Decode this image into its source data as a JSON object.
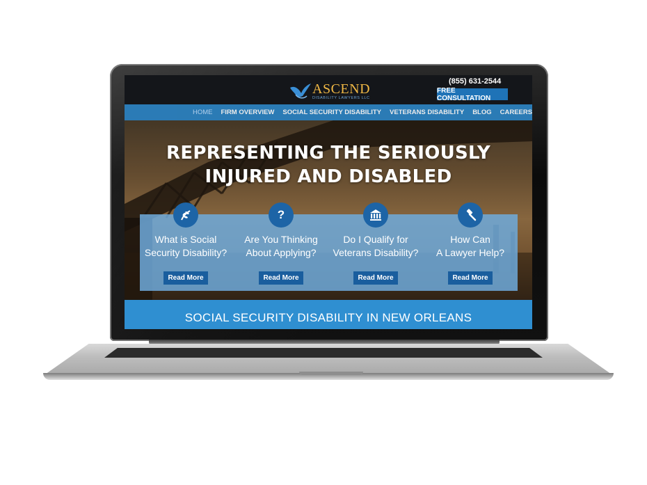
{
  "header": {
    "logo_text": "ASCEND",
    "logo_subtext": "DISABILITY LAWYERS LLC",
    "phone": "(855) 631-2544",
    "consult_label": "FREE CONSULTATION"
  },
  "nav": {
    "items": [
      {
        "label": "HOME",
        "active": true
      },
      {
        "label": "FIRM OVERVIEW"
      },
      {
        "label": "SOCIAL SECURITY DISABILITY"
      },
      {
        "label": "VETERANS DISABILITY"
      },
      {
        "label": "BLOG"
      },
      {
        "label": "CAREERS"
      }
    ]
  },
  "hero": {
    "headline_line1": "REPRESENTING THE SERIOUSLY",
    "headline_line2": "INJURED AND DISABLED"
  },
  "cards": [
    {
      "icon": "leaf-icon",
      "title_line1": "What is Social",
      "title_line2": "Security Disability?",
      "button": "Read More"
    },
    {
      "icon": "question-icon",
      "glyph": "?",
      "title_line1": "Are You Thinking",
      "title_line2": "About Applying?",
      "button": "Read More"
    },
    {
      "icon": "government-building-icon",
      "title_line1": "Do I Qualify for",
      "title_line2": "Veterans Disability?",
      "button": "Read More"
    },
    {
      "icon": "gavel-icon",
      "title_line1": "How Can",
      "title_line2": "A Lawyer Help?",
      "button": "Read More"
    }
  ],
  "banner": {
    "title": "SOCIAL SECURITY DISABILITY IN NEW ORLEANS"
  },
  "colors": {
    "nav_bg": "#2f86c5",
    "button_blue": "#1f73b7",
    "logo_gold": "#f0b845",
    "banner_blue": "#2f8fd1"
  }
}
